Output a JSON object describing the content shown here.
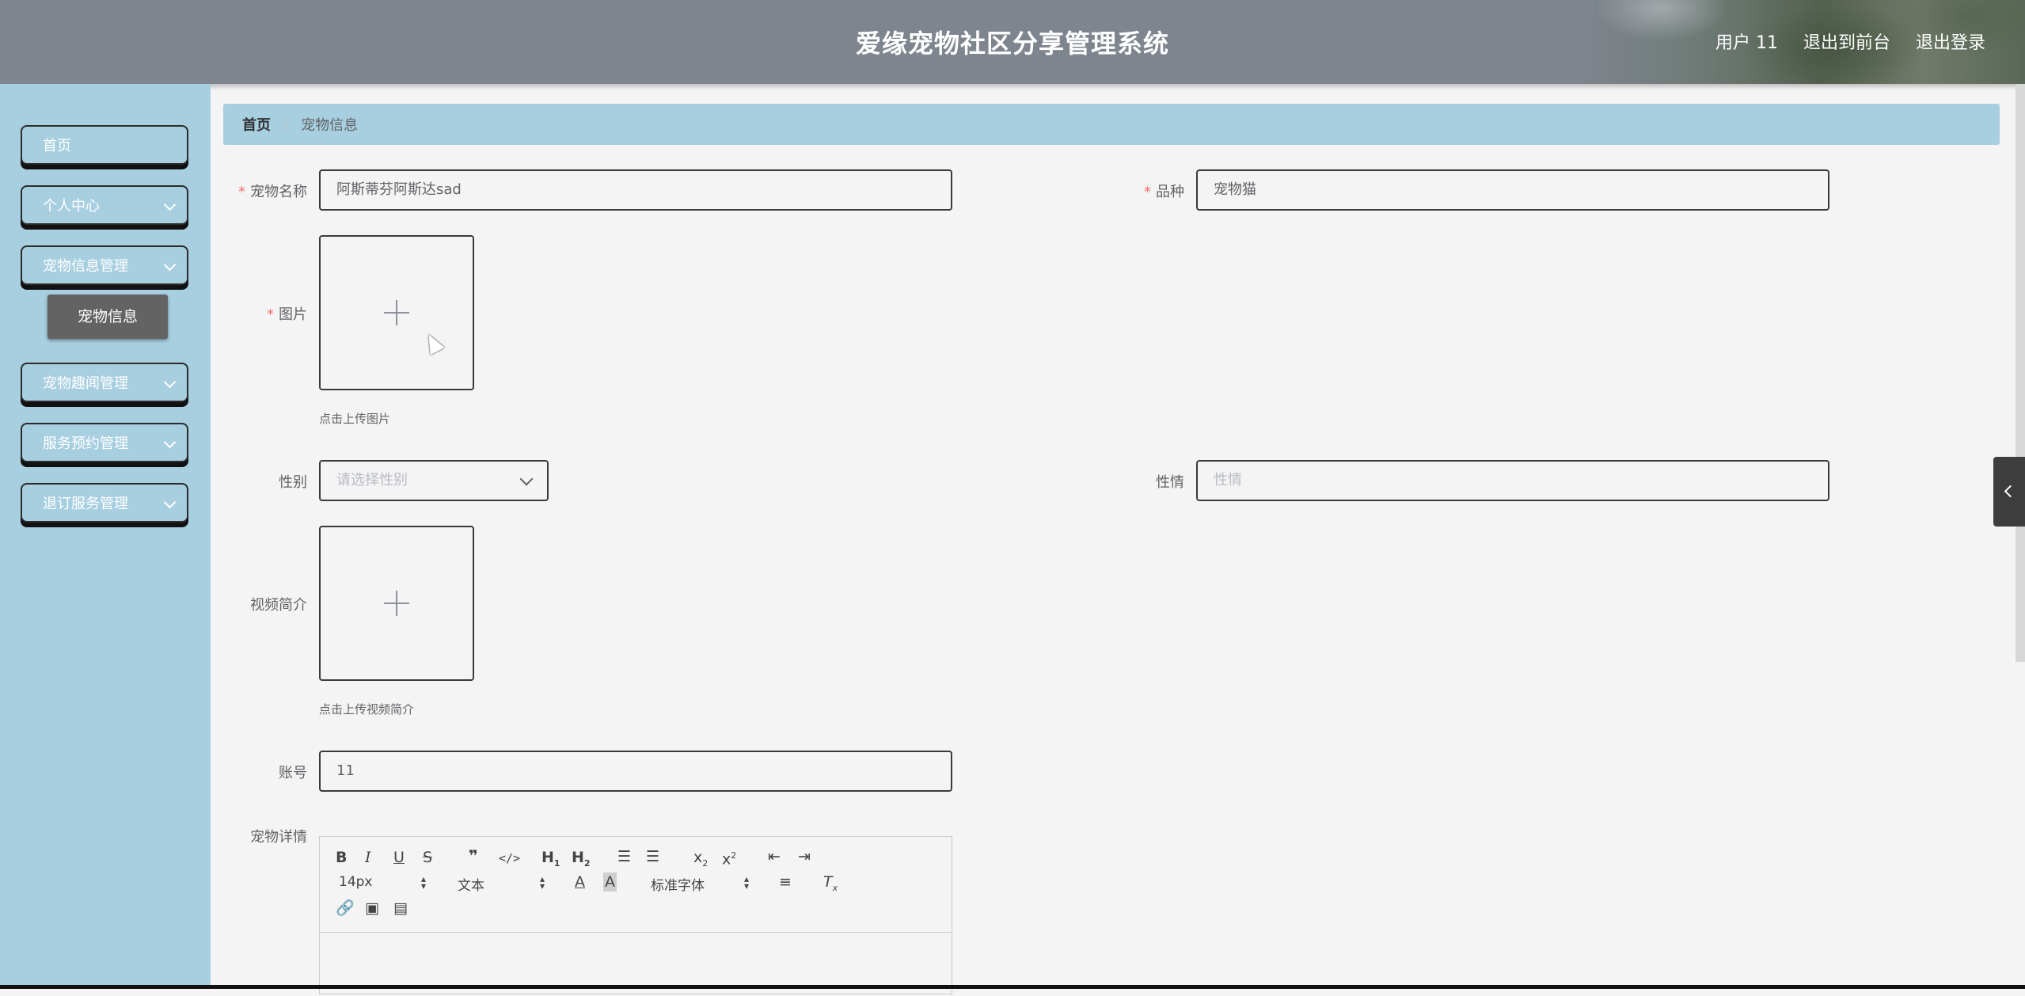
{
  "header": {
    "title": "爱缘宠物社区分享管理系统",
    "user": "用户 11",
    "to_front": "退出到前台",
    "logout": "退出登录"
  },
  "sidebar": {
    "items": [
      {
        "label": "首页",
        "expandable": false
      },
      {
        "label": "个人中心",
        "expandable": true
      },
      {
        "label": "宠物信息管理",
        "expandable": true
      },
      {
        "label": "宠物趣闻管理",
        "expandable": true
      },
      {
        "label": "服务预约管理",
        "expandable": true
      },
      {
        "label": "退订服务管理",
        "expandable": true
      }
    ],
    "active_sub": "宠物信息"
  },
  "breadcrumb": {
    "home": "首页",
    "separator": "/",
    "current": "宠物信息"
  },
  "form": {
    "pet_name": {
      "label": "宠物名称",
      "value": "阿斯蒂芬阿斯达sad",
      "required": true
    },
    "breed": {
      "label": "品种",
      "value": "宠物猫",
      "required": true
    },
    "image": {
      "label": "图片",
      "hint": "点击上传图片",
      "required": true
    },
    "gender": {
      "label": "性别",
      "placeholder": "请选择性别"
    },
    "temper": {
      "label": "性情",
      "placeholder": "性情"
    },
    "video": {
      "label": "视频简介",
      "hint": "点击上传视频简介"
    },
    "account": {
      "label": "账号",
      "value": "11"
    },
    "details": {
      "label": "宠物详情"
    }
  },
  "editor": {
    "font_size": "14px",
    "text_style": "文本",
    "font_family": "标准字体",
    "buttons": [
      "B",
      "I",
      "U",
      "S",
      "99",
      "</>",
      "H1",
      "H2",
      "ordered-list",
      "bullet-list",
      "x2-sub",
      "x2-sup",
      "outdent",
      "indent",
      "font-color",
      "background-color",
      "align",
      "clean",
      "link",
      "image",
      "video"
    ]
  },
  "colors": {
    "header_bg": "#7e858e",
    "sidebar_bg": "#a8cfe0",
    "breadcrumb_bg": "#a8cfe0",
    "required": "#f56c6c",
    "active_sub_bg": "#636363"
  }
}
